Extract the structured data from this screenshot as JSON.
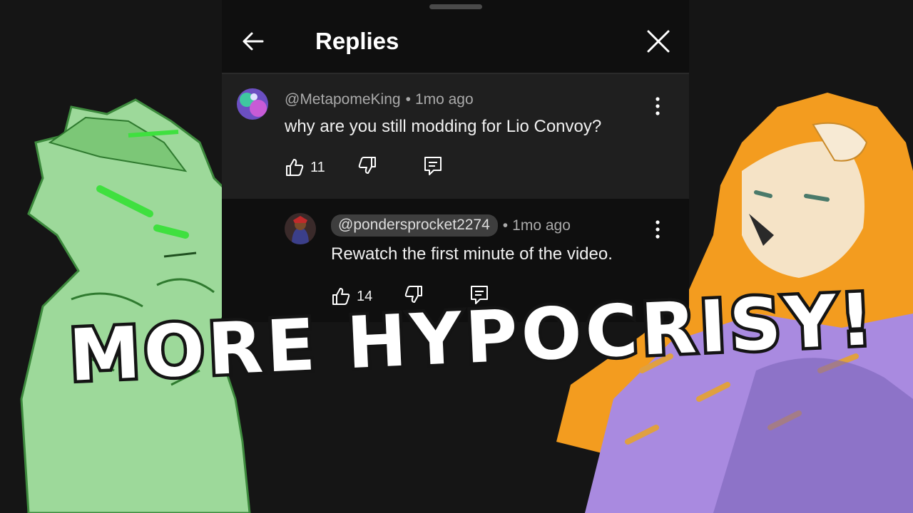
{
  "panel": {
    "title": "Replies",
    "back_icon": "arrow-left-icon",
    "close_icon": "close-icon"
  },
  "comments": [
    {
      "author": "@MetapomeKing",
      "separator": "•",
      "time": "1mo ago",
      "text": "why are you still modding for Lio Convoy?",
      "likes": "11",
      "highlighted": true
    },
    {
      "author": "@pondersprocket2274",
      "separator": "•",
      "time": "1mo ago",
      "text": "Rewatch the first minute of the video.",
      "likes": "14",
      "highlighted": false
    }
  ],
  "icons": {
    "like": "thumbs-up-icon",
    "dislike": "thumbs-down-icon",
    "reply": "reply-comment-icon",
    "more": "more-vertical-icon"
  },
  "headline": "MORE HYPOCRISY!",
  "colors": {
    "background": "#151515",
    "panel": "#0f0f0f",
    "highlight_row": "#1f1f1f",
    "green_character": "#8fd38f",
    "lion_mane": "#f39c1f",
    "lion_fur": "#a98ae0"
  }
}
